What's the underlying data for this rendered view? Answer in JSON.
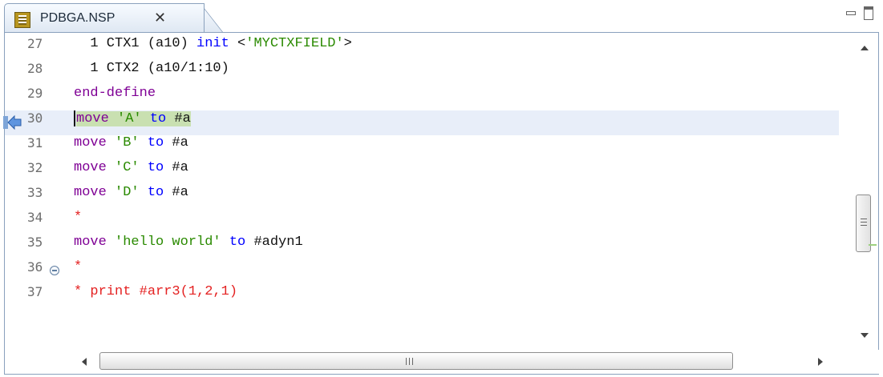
{
  "tab": {
    "title": "PDBGA.NSP",
    "close_glyph": "✕",
    "file_icon": "natural-source-file-icon"
  },
  "window_controls": {
    "minimize_icon": "minimize-icon",
    "maximize_icon": "maximize-icon"
  },
  "editor": {
    "current_line": 30,
    "lines": [
      {
        "n": "27",
        "tokens": [
          {
            "t": "  1 CTX1 (a10) ",
            "c": "ident"
          },
          {
            "t": "init",
            "c": "kw-blue"
          },
          {
            "t": " <",
            "c": "ident"
          },
          {
            "t": "'MYCTXFIELD'",
            "c": "str-green"
          },
          {
            "t": ">",
            "c": "ident"
          }
        ]
      },
      {
        "n": "28",
        "tokens": [
          {
            "t": "  1 CTX2 (a10/1:10)",
            "c": "ident"
          }
        ]
      },
      {
        "n": "29",
        "tokens": [
          {
            "t": "end-define",
            "c": "kw-purple"
          }
        ]
      },
      {
        "n": "30",
        "tokens": [
          {
            "t": "move",
            "c": "kw-purple"
          },
          {
            "t": " ",
            "c": "ident"
          },
          {
            "t": "'A'",
            "c": "str-green"
          },
          {
            "t": " ",
            "c": "ident"
          },
          {
            "t": "to",
            "c": "kw-blue"
          },
          {
            "t": " #a",
            "c": "ident"
          }
        ]
      },
      {
        "n": "31",
        "tokens": [
          {
            "t": "move",
            "c": "kw-purple"
          },
          {
            "t": " ",
            "c": "ident"
          },
          {
            "t": "'B'",
            "c": "str-green"
          },
          {
            "t": " ",
            "c": "ident"
          },
          {
            "t": "to",
            "c": "kw-blue"
          },
          {
            "t": " #a",
            "c": "ident"
          }
        ]
      },
      {
        "n": "32",
        "tokens": [
          {
            "t": "move",
            "c": "kw-purple"
          },
          {
            "t": " ",
            "c": "ident"
          },
          {
            "t": "'C'",
            "c": "str-green"
          },
          {
            "t": " ",
            "c": "ident"
          },
          {
            "t": "to",
            "c": "kw-blue"
          },
          {
            "t": " #a",
            "c": "ident"
          }
        ]
      },
      {
        "n": "33",
        "tokens": [
          {
            "t": "move",
            "c": "kw-purple"
          },
          {
            "t": " ",
            "c": "ident"
          },
          {
            "t": "'D'",
            "c": "str-green"
          },
          {
            "t": " ",
            "c": "ident"
          },
          {
            "t": "to",
            "c": "kw-blue"
          },
          {
            "t": " #a",
            "c": "ident"
          }
        ]
      },
      {
        "n": "34",
        "tokens": [
          {
            "t": "*",
            "c": "comment-red"
          }
        ]
      },
      {
        "n": "35",
        "tokens": [
          {
            "t": "move",
            "c": "kw-purple"
          },
          {
            "t": " ",
            "c": "ident"
          },
          {
            "t": "'hello world'",
            "c": "str-green"
          },
          {
            "t": " ",
            "c": "ident"
          },
          {
            "t": "to",
            "c": "kw-blue"
          },
          {
            "t": " #adyn1",
            "c": "ident"
          }
        ]
      },
      {
        "n": "36",
        "fold": true,
        "tokens": [
          {
            "t": "*",
            "c": "comment-red"
          }
        ]
      },
      {
        "n": "37",
        "tokens": [
          {
            "t": "* print #arr3(1,2,1)",
            "c": "comment-red"
          }
        ]
      }
    ]
  },
  "scrollbars": {
    "vertical": {
      "up_icon": "scroll-up-icon",
      "down_icon": "scroll-down-icon",
      "thumb_icon": "scroll-thumb-grip-icon"
    },
    "horizontal": {
      "left_icon": "scroll-left-icon",
      "right_icon": "scroll-right-icon",
      "thumb_icon": "scroll-thumb-grip-icon"
    }
  },
  "colors": {
    "keyword_purple": "#7f0095",
    "keyword_blue": "#0000ff",
    "string_green": "#2a8a00",
    "comment_red": "#e42222",
    "current_line": "#e8eef9",
    "current_statement": "#c9e0b1"
  }
}
